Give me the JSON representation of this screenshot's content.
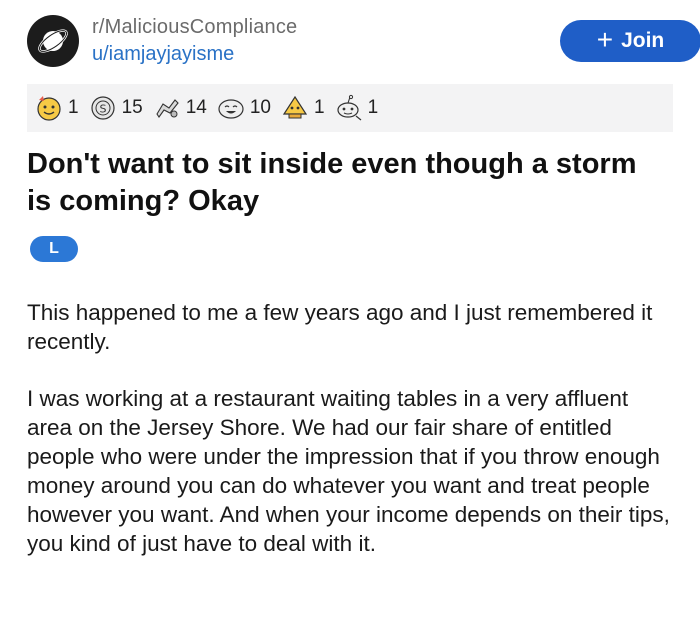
{
  "header": {
    "subreddit": "r/MaliciousCompliance",
    "username": "u/iamjayjayisme",
    "join_label": "Join",
    "join_icon": "plus-icon",
    "avatar_icon": "planet-icon"
  },
  "awards": [
    {
      "icon": "wholesome-award-icon",
      "count": "1"
    },
    {
      "icon": "silver-coin-award-icon",
      "count": "15"
    },
    {
      "icon": "helpful-award-icon",
      "count": "14"
    },
    {
      "icon": "laughing-award-icon",
      "count": "10"
    },
    {
      "icon": "rocket-award-icon",
      "count": "1"
    },
    {
      "icon": "snoo-award-icon",
      "count": "1"
    }
  ],
  "post": {
    "title": "Don't want to sit inside even though a storm is coming? Okay",
    "flair": "L",
    "paragraphs": [
      "This happened to me a few years ago and I just remembered it recently.",
      "I was working at a restaurant waiting tables in a very affluent area on the Jersey Shore.  We had our fair share of entitled people who were under the impression that if you throw enough money around you can do whatever you want and treat people however you want. And when your income depends on their tips, you kind of just have to deal with it."
    ]
  },
  "colors": {
    "join_bg": "#1f5ec7",
    "flair_bg": "#2c78d6",
    "username": "#2a72c6",
    "award_bar_bg": "#f3f3f4"
  }
}
